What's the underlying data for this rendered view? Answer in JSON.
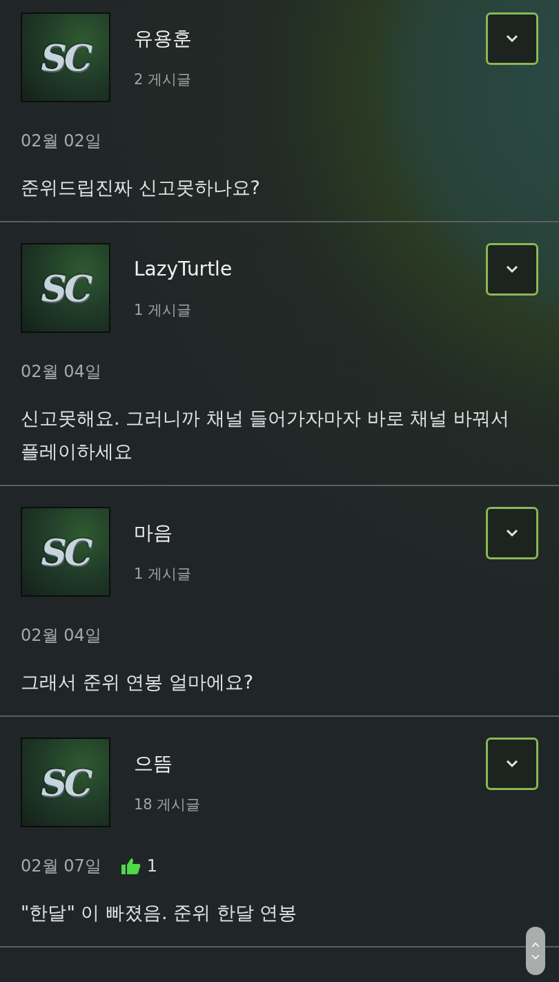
{
  "posts": [
    {
      "author": "유용훈",
      "avatar_logo": "SC",
      "post_count": "2 게시글",
      "date": "02월 02일",
      "body": "준위드립진짜 신고못하나요?"
    },
    {
      "author": "LazyTurtle",
      "avatar_logo": "SC",
      "post_count": "1 게시글",
      "date": "02월 04일",
      "body": "신고못해요. 그러니까 채널 들어가자마자 바로 채널 바꿔서 플레이하세요"
    },
    {
      "author": "마음",
      "avatar_logo": "SC",
      "post_count": "1 게시글",
      "date": "02월 04일",
      "body": "그래서 준위 연봉 얼마에요?"
    },
    {
      "author": "으뜸",
      "avatar_logo": "SC",
      "post_count": "18 게시글",
      "date": "02월 07일",
      "likes": "1",
      "body": "\"한달\" 이 빠졌음. 준위 한달 연봉"
    }
  ]
}
